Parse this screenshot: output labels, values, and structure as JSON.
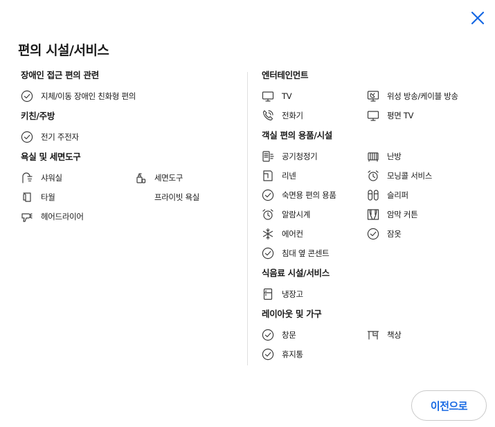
{
  "dialog": {
    "title": "편의 시설/서비스",
    "back_label": "이전으로",
    "accent": "#1668e3"
  },
  "left": [
    {
      "title": "장애인 접근 편의 관련",
      "items": [
        {
          "label": "지체/이동 장애인 친화형 편의",
          "icon": "check-circle-icon"
        }
      ]
    },
    {
      "title": "키친/주방",
      "items": [
        {
          "label": "전기 주전자",
          "icon": "check-circle-icon"
        }
      ]
    },
    {
      "title": "욕실 및 세면도구",
      "items": [
        {
          "label": "샤워실",
          "icon": "shower-icon"
        },
        {
          "label": "세면도구",
          "icon": "toiletries-icon"
        },
        {
          "label": "타월",
          "icon": "towel-icon"
        },
        {
          "label": "프라이빗 욕실",
          "icon": ""
        },
        {
          "label": "헤어드라이어",
          "icon": "hairdryer-icon"
        }
      ]
    }
  ],
  "right": [
    {
      "title": "엔터테인먼트",
      "items": [
        {
          "label": "TV",
          "icon": "tv-icon"
        },
        {
          "label": "위성 방송/케이블 방송",
          "icon": "satellite-tv-icon"
        },
        {
          "label": "전화기",
          "icon": "phone-icon"
        },
        {
          "label": "평면 TV",
          "icon": "tv-icon"
        }
      ]
    },
    {
      "title": "객실 편의 용품/시설",
      "items": [
        {
          "label": "공기청정기",
          "icon": "air-purifier-icon"
        },
        {
          "label": "난방",
          "icon": "heater-icon"
        },
        {
          "label": "리넨",
          "icon": "linen-icon"
        },
        {
          "label": "모닝콜 서비스",
          "icon": "alarm-clock-icon"
        },
        {
          "label": "숙면용 편의 용품",
          "icon": "check-circle-icon"
        },
        {
          "label": "슬리퍼",
          "icon": "slippers-icon"
        },
        {
          "label": "알람시계",
          "icon": "alarm-clock-icon"
        },
        {
          "label": "암막 커튼",
          "icon": "curtain-icon"
        },
        {
          "label": "에어컨",
          "icon": "snowflake-icon"
        },
        {
          "label": "잠옷",
          "icon": "check-circle-icon"
        },
        {
          "label": "침대 옆 콘센트",
          "icon": "check-circle-icon"
        }
      ]
    },
    {
      "title": "식음료 시설/서비스",
      "items": [
        {
          "label": "냉장고",
          "icon": "fridge-icon"
        }
      ]
    },
    {
      "title": "레이아웃 및 가구",
      "items": [
        {
          "label": "창문",
          "icon": "check-circle-icon"
        },
        {
          "label": "책상",
          "icon": "desk-icon"
        },
        {
          "label": "휴지통",
          "icon": "check-circle-icon"
        }
      ]
    }
  ]
}
